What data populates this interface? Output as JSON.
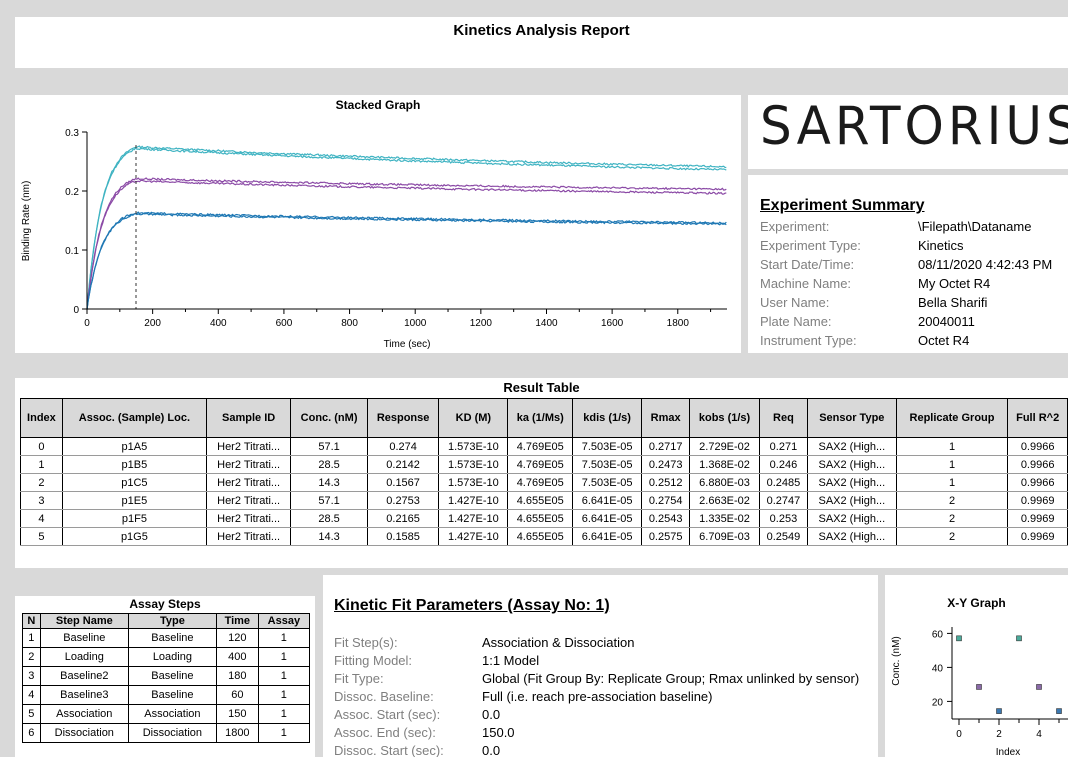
{
  "report_title": "Kinetics Analysis Report",
  "stacked_graph": {
    "title": "Stacked Graph",
    "xlabel": "Time (sec)",
    "ylabel": "Binding Rate (nm)",
    "xticks": [
      "0",
      "200",
      "400",
      "600",
      "800",
      "1000",
      "1200",
      "1400",
      "1600",
      "1800"
    ],
    "yticks": [
      "0",
      "0.1",
      "0.2",
      "0.3"
    ]
  },
  "logo": {
    "text": "SARTORIUS"
  },
  "summary": {
    "title": "Experiment Summary",
    "rows": [
      {
        "label": "Experiment:",
        "value": "\\Filepath\\Dataname"
      },
      {
        "label": "Experiment Type:",
        "value": "Kinetics"
      },
      {
        "label": "Start Date/Time:",
        "value": "08/11/2020 4:42:43 PM"
      },
      {
        "label": "Machine Name:",
        "value": "My Octet R4"
      },
      {
        "label": "User Name:",
        "value": "Bella Sharifi"
      },
      {
        "label": "Plate Name:",
        "value": "20040011"
      },
      {
        "label": "Instrument Type:",
        "value": "Octet R4"
      }
    ]
  },
  "result_table": {
    "title": "Result Table",
    "columns": [
      "Index",
      "Assoc. (Sample) Loc.",
      "Sample ID",
      "Conc. (nM)",
      "Response",
      "KD (M)",
      "ka (1/Ms)",
      "kdis (1/s)",
      "Rmax",
      "kobs (1/s)",
      "Req",
      "Sensor Type",
      "Replicate Group",
      "Full R^2"
    ],
    "rows": [
      [
        "0",
        "p1A5",
        "Her2 Titrati...",
        "57.1",
        "0.274",
        "1.573E-10",
        "4.769E05",
        "7.503E-05",
        "0.2717",
        "2.729E-02",
        "0.271",
        "SAX2 (High...",
        "1",
        "0.9966"
      ],
      [
        "1",
        "p1B5",
        "Her2 Titrati...",
        "28.5",
        "0.2142",
        "1.573E-10",
        "4.769E05",
        "7.503E-05",
        "0.2473",
        "1.368E-02",
        "0.246",
        "SAX2 (High...",
        "1",
        "0.9966"
      ],
      [
        "2",
        "p1C5",
        "Her2 Titrati...",
        "14.3",
        "0.1567",
        "1.573E-10",
        "4.769E05",
        "7.503E-05",
        "0.2512",
        "6.880E-03",
        "0.2485",
        "SAX2 (High...",
        "1",
        "0.9966"
      ],
      [
        "3",
        "p1E5",
        "Her2 Titrati...",
        "57.1",
        "0.2753",
        "1.427E-10",
        "4.655E05",
        "6.641E-05",
        "0.2754",
        "2.663E-02",
        "0.2747",
        "SAX2 (High...",
        "2",
        "0.9969"
      ],
      [
        "4",
        "p1F5",
        "Her2 Titrati...",
        "28.5",
        "0.2165",
        "1.427E-10",
        "4.655E05",
        "6.641E-05",
        "0.2543",
        "1.335E-02",
        "0.253",
        "SAX2 (High...",
        "2",
        "0.9969"
      ],
      [
        "5",
        "p1G5",
        "Her2 Titrati...",
        "14.3",
        "0.1585",
        "1.427E-10",
        "4.655E05",
        "6.641E-05",
        "0.2575",
        "6.709E-03",
        "0.2549",
        "SAX2 (High...",
        "2",
        "0.9969"
      ]
    ]
  },
  "assay_steps": {
    "title": "Assay Steps",
    "columns": [
      "N",
      "Step Name",
      "Type",
      "Time",
      "Assay"
    ],
    "rows": [
      [
        "1",
        "Baseline",
        "Baseline",
        "120",
        "1"
      ],
      [
        "2",
        "Loading",
        "Loading",
        "400",
        "1"
      ],
      [
        "3",
        "Baseline2",
        "Baseline",
        "180",
        "1"
      ],
      [
        "4",
        "Baseline3",
        "Baseline",
        "60",
        "1"
      ],
      [
        "5",
        "Association",
        "Association",
        "150",
        "1"
      ],
      [
        "6",
        "Dissociation",
        "Dissociation",
        "1800",
        "1"
      ]
    ]
  },
  "kinetic_fit": {
    "title": "Kinetic Fit Parameters (Assay No: 1)",
    "rows": [
      {
        "label": "Fit Step(s):",
        "value": "Association & Dissociation"
      },
      {
        "label": "Fitting Model:",
        "value": "1:1 Model"
      },
      {
        "label": "Fit Type:",
        "value": "Global (Fit Group By: Replicate Group; Rmax unlinked by sensor)"
      },
      {
        "label": "Dissoc. Baseline:",
        "value": "Full (i.e. reach pre-association baseline)"
      },
      {
        "label": "Assoc. Start (sec):",
        "value": "0.0"
      },
      {
        "label": "Assoc. End (sec):",
        "value": "150.0"
      },
      {
        "label": "Dissoc. Start (sec):",
        "value": "0.0"
      }
    ]
  },
  "xy_graph": {
    "title": "X-Y Graph",
    "xlabel": "Index",
    "ylabel": "Conc. (nM)",
    "xticks": [
      "0",
      "2",
      "4"
    ],
    "yticks": [
      "20",
      "40",
      "60"
    ]
  },
  "chart_data": [
    {
      "type": "line",
      "title": "Stacked Graph",
      "xlabel": "Time (sec)",
      "ylabel": "Binding Rate (nm)",
      "xlim": [
        0,
        1950
      ],
      "ylim": [
        0,
        0.3
      ],
      "association_end": 150,
      "series": [
        {
          "color": "#3fb3c2",
          "values_at": [
            [
              0,
              0
            ],
            [
              150,
              0.275
            ],
            [
              1950,
              0.241
            ]
          ]
        },
        {
          "color": "#3fb3c2",
          "values_at": [
            [
              0,
              0
            ],
            [
              150,
              0.272
            ],
            [
              1950,
              0.236
            ]
          ]
        },
        {
          "color": "#8b4aa6",
          "values_at": [
            [
              0,
              0
            ],
            [
              150,
              0.221
            ],
            [
              1950,
              0.203
            ]
          ]
        },
        {
          "color": "#8b4aa6",
          "values_at": [
            [
              0,
              0
            ],
            [
              150,
              0.217
            ],
            [
              1950,
              0.196
            ]
          ]
        },
        {
          "color": "#1f78b4",
          "values_at": [
            [
              0,
              0
            ],
            [
              150,
              0.163
            ],
            [
              1950,
              0.146
            ]
          ]
        },
        {
          "color": "#1f78b4",
          "values_at": [
            [
              0,
              0
            ],
            [
              150,
              0.161
            ],
            [
              1950,
              0.144
            ]
          ]
        }
      ]
    },
    {
      "type": "scatter",
      "title": "X-Y Graph",
      "xlabel": "Index",
      "ylabel": "Conc. (nM)",
      "xlim": [
        -0.2,
        5.2
      ],
      "ylim": [
        12,
        62
      ],
      "points": [
        {
          "x": 0,
          "y": 57.1,
          "color": "#4bab9b"
        },
        {
          "x": 1,
          "y": 28.5,
          "color": "#8b6aa8"
        },
        {
          "x": 2,
          "y": 14.3,
          "color": "#3b78b0"
        },
        {
          "x": 3,
          "y": 57.1,
          "color": "#4bab9b"
        },
        {
          "x": 4,
          "y": 28.5,
          "color": "#8b6aa8"
        },
        {
          "x": 5,
          "y": 14.3,
          "color": "#3b78b0"
        }
      ]
    }
  ]
}
